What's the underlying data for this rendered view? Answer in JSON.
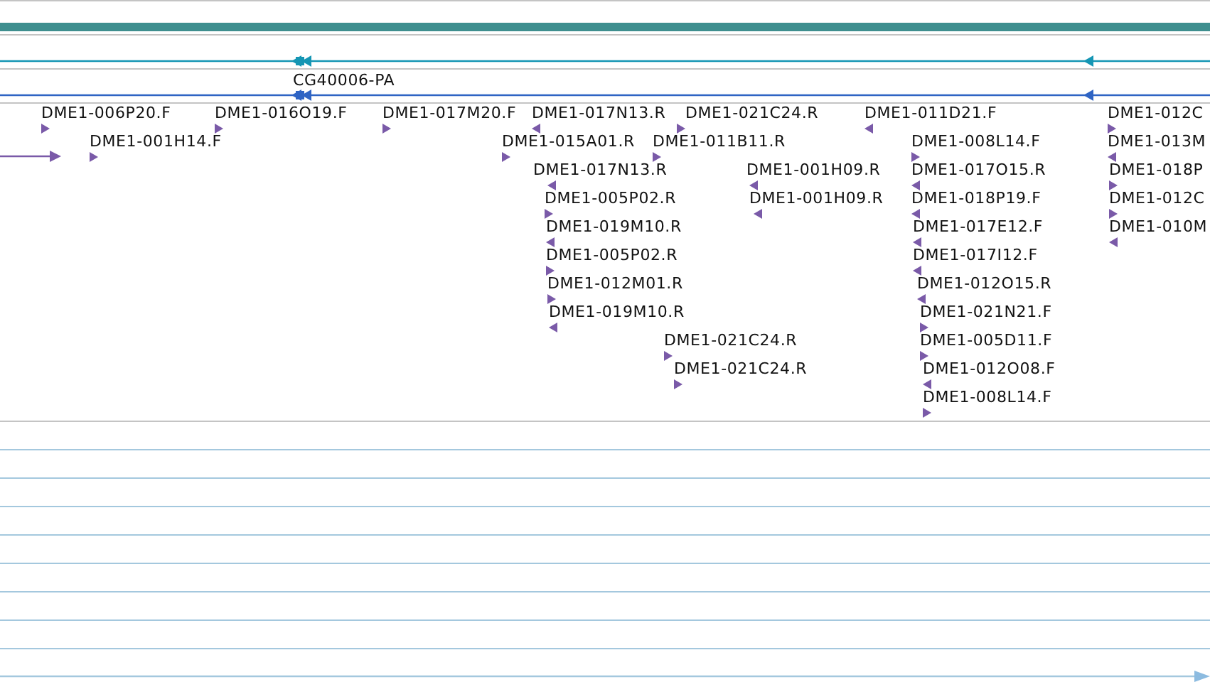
{
  "gene": {
    "label": "CG40006-PA",
    "reverse": true
  },
  "features": [
    {
      "label": "DME1-006P20.F",
      "reverse": false
    },
    {
      "label": "DME1-016O19.F",
      "reverse": false
    },
    {
      "label": "DME1-017M20.F",
      "reverse": false
    },
    {
      "label": "DME1-017N13.R",
      "reverse": true
    },
    {
      "label": "DME1-021C24.R",
      "reverse": false
    },
    {
      "label": "DME1-011D21.F",
      "reverse": true
    },
    {
      "label": "DME1-012C",
      "reverse": false
    },
    {
      "label": "DME1-001H14.F",
      "reverse": false
    },
    {
      "label": "DME1-015A01.R",
      "reverse": false
    },
    {
      "label": "DME1-011B11.R",
      "reverse": false
    },
    {
      "label": "DME1-008L14.F",
      "reverse": false
    },
    {
      "label": "DME1-013M",
      "reverse": true
    },
    {
      "label": "DME1-017N13.R",
      "reverse": true
    },
    {
      "label": "DME1-001H09.R",
      "reverse": true
    },
    {
      "label": "DME1-017O15.R",
      "reverse": true
    },
    {
      "label": "DME1-018P",
      "reverse": false
    },
    {
      "label": "DME1-005P02.R",
      "reverse": false
    },
    {
      "label": "DME1-001H09.R",
      "reverse": true
    },
    {
      "label": "DME1-018P19.F",
      "reverse": true
    },
    {
      "label": "DME1-012C",
      "reverse": false
    },
    {
      "label": "DME1-019M10.R",
      "reverse": true
    },
    {
      "label": "DME1-017E12.F",
      "reverse": true
    },
    {
      "label": "DME1-010M",
      "reverse": true
    },
    {
      "label": "DME1-005P02.R",
      "reverse": false
    },
    {
      "label": "DME1-017I12.F",
      "reverse": true
    },
    {
      "label": "DME1-012M01.R",
      "reverse": false
    },
    {
      "label": "DME1-012O15.R",
      "reverse": true
    },
    {
      "label": "DME1-019M10.R",
      "reverse": true
    },
    {
      "label": "DME1-021N21.F",
      "reverse": false
    },
    {
      "label": "DME1-021C24.R",
      "reverse": false
    },
    {
      "label": "DME1-005D11.F",
      "reverse": false
    },
    {
      "label": "DME1-021C24.R",
      "reverse": false
    },
    {
      "label": "DME1-012O08.F",
      "reverse": true
    },
    {
      "label": "DME1-008L14.F",
      "reverse": false
    }
  ]
}
